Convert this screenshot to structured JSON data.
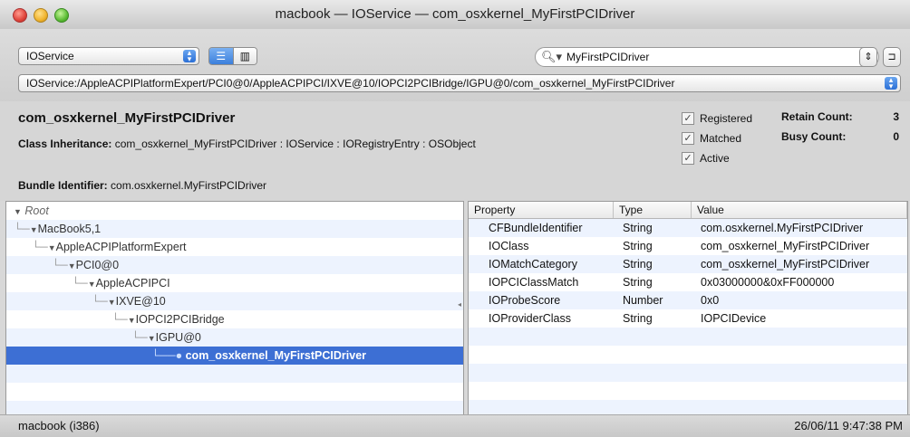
{
  "window": {
    "title": "macbook — IOService — com_osxkernel_MyFirstPCIDriver"
  },
  "toolbar": {
    "plane_select": "IOService",
    "search_value": "MyFirstPCIDriver",
    "path_value": "IOService:/AppleACPIPlatformExpert/PCI0@0/AppleACPIPCI/IXVE@10/IOPCI2PCIBridge/IGPU@0/com_osxkernel_MyFirstPCIDriver"
  },
  "info": {
    "class_name": "com_osxkernel_MyFirstPCIDriver",
    "inheritance_label": "Class Inheritance:",
    "inheritance_value": "com_osxkernel_MyFirstPCIDriver : IOService : IORegistryEntry : OSObject",
    "bundle_label": "Bundle Identifier:",
    "bundle_value": "com.osxkernel.MyFirstPCIDriver",
    "checks": {
      "registered": "Registered",
      "matched": "Matched",
      "active": "Active"
    },
    "retain_label": "Retain Count:",
    "retain_value": "3",
    "busy_label": "Busy Count:",
    "busy_value": "0"
  },
  "tree": {
    "root": "Root",
    "n1": "MacBook5,1",
    "n2": "AppleACPIPlatformExpert",
    "n3": "PCI0@0",
    "n4": "AppleACPIPCI",
    "n5": "IXVE@10",
    "n6": "IOPCI2PCIBridge",
    "n7": "IGPU@0",
    "n8": "com_osxkernel_MyFirstPCIDriver"
  },
  "props": {
    "headers": {
      "property": "Property",
      "type": "Type",
      "value": "Value"
    },
    "rows": [
      {
        "property": "CFBundleIdentifier",
        "type": "String",
        "value": "com.osxkernel.MyFirstPCIDriver"
      },
      {
        "property": "IOClass",
        "type": "String",
        "value": "com_osxkernel_MyFirstPCIDriver"
      },
      {
        "property": "IOMatchCategory",
        "type": "String",
        "value": "com_osxkernel_MyFirstPCIDriver"
      },
      {
        "property": "IOPCIClassMatch",
        "type": "String",
        "value": "0x03000000&0xFF000000"
      },
      {
        "property": "IOProbeScore",
        "type": "Number",
        "value": "0x0"
      },
      {
        "property": "IOProviderClass",
        "type": "String",
        "value": "IOPCIDevice"
      }
    ]
  },
  "status": {
    "left": "macbook (i386)",
    "right": "26/06/11 9:47:38 PM"
  },
  "icons": [
    "search-icon",
    "clear-icon",
    "list-view-icon",
    "column-view-icon",
    "disclosure-triangle-icon"
  ]
}
